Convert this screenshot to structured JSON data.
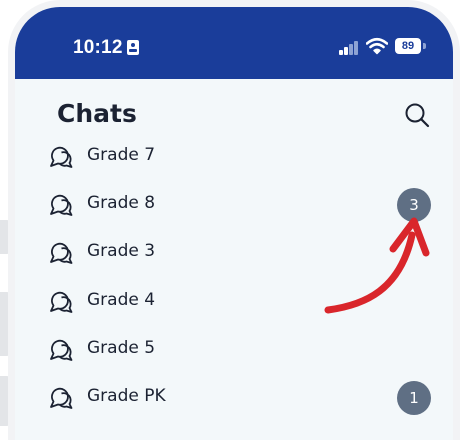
{
  "status_bar": {
    "time": "10:12",
    "battery": "89"
  },
  "header": {
    "title": "Chats"
  },
  "chats": [
    {
      "label": "Grade 7",
      "badge": ""
    },
    {
      "label": "Grade 8",
      "badge": "3"
    },
    {
      "label": "Grade 3",
      "badge": ""
    },
    {
      "label": "Grade 4",
      "badge": ""
    },
    {
      "label": "Grade 5",
      "badge": ""
    },
    {
      "label": "Grade PK",
      "badge": "1"
    }
  ],
  "colors": {
    "header_bg": "#1a3d9a",
    "screen_bg": "#f3f8fa",
    "badge_bg": "#5f6f84",
    "annotation_arrow": "#d9262b"
  },
  "icons": [
    "id-card-icon",
    "signal-icon",
    "wifi-icon",
    "battery-icon",
    "search-icon",
    "chat-bubbles-icon"
  ]
}
